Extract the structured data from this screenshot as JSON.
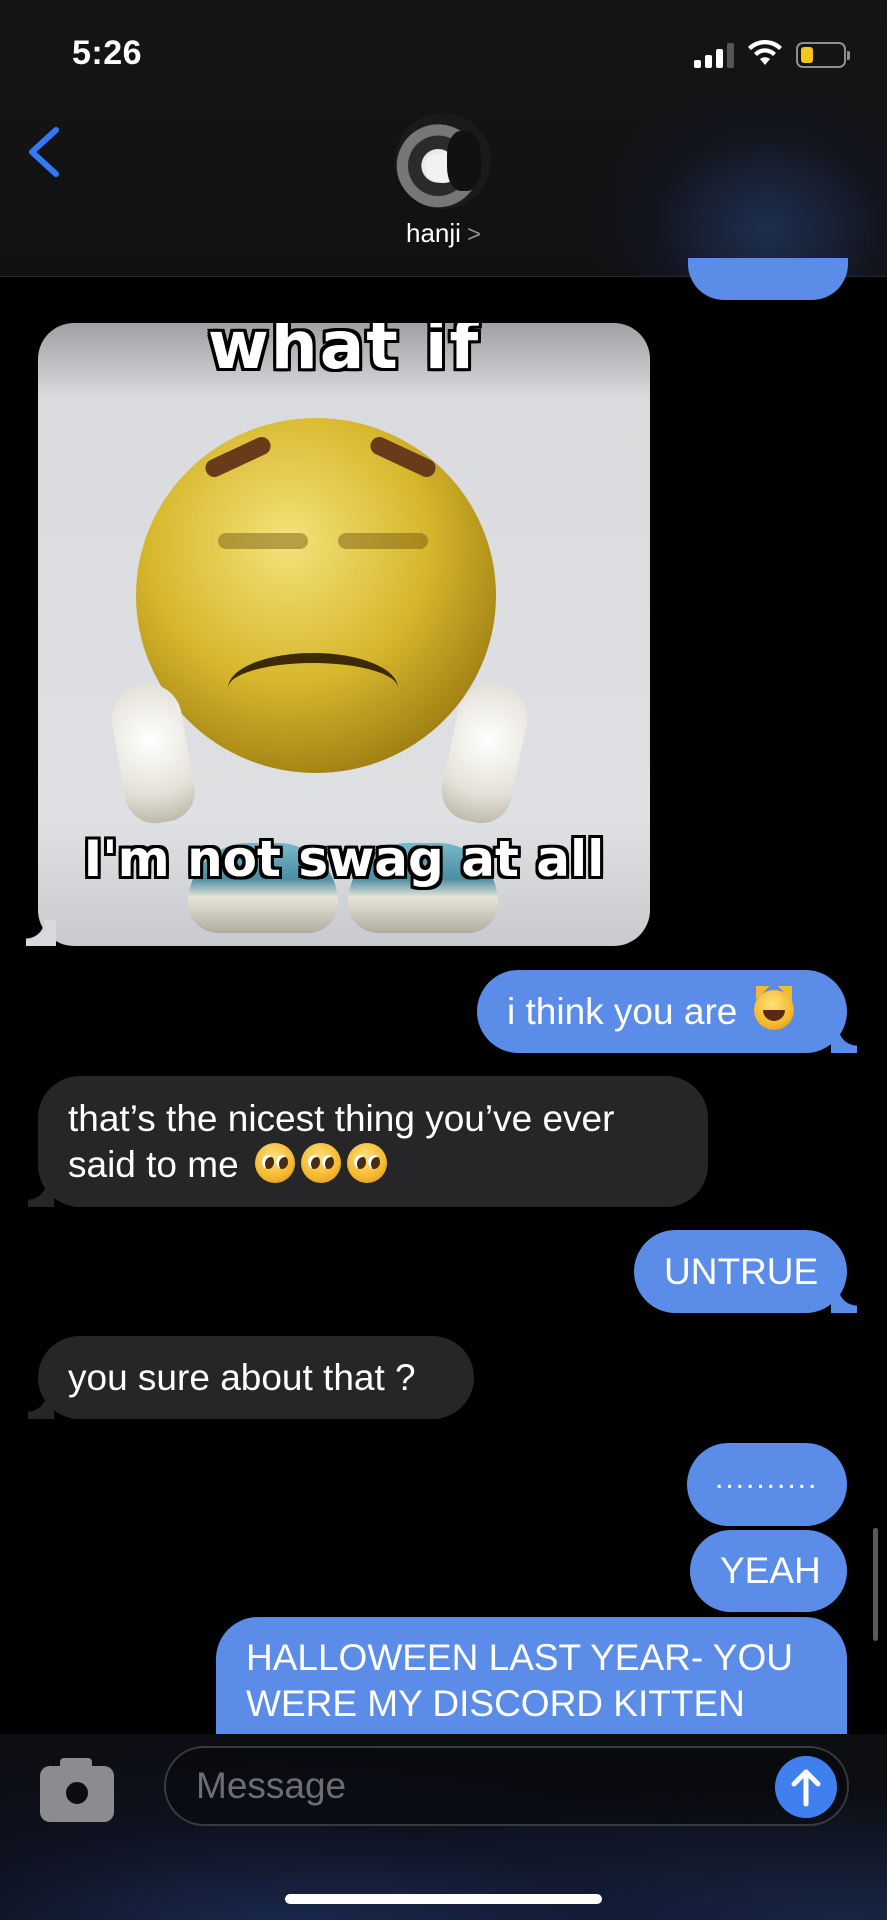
{
  "status_bar": {
    "time": "5:26",
    "icons": [
      "cellular-signal-icon",
      "wifi-icon",
      "battery-low-icon"
    ]
  },
  "header": {
    "contact_name": "hanji",
    "chevron": ">",
    "back_icon": "chevron-left-icon",
    "accent": "#3478f6"
  },
  "meme": {
    "caption_top": "what if",
    "caption_bottom": "I'm not swag at all"
  },
  "messages": [
    {
      "from": "me",
      "text": "i think you are",
      "emoji": [
        "grinning-cat-emoji"
      ]
    },
    {
      "from": "them",
      "line1": "that’s the nicest thing you’ve ever",
      "line2": "said to me",
      "emoji": [
        "pleading-face-emoji",
        "pleading-face-emoji",
        "pleading-face-emoji"
      ]
    },
    {
      "from": "me",
      "text": "UNTRUE"
    },
    {
      "from": "them",
      "text": "you sure about that ?"
    },
    {
      "from": "me",
      "text": ".........."
    },
    {
      "from": "me",
      "text": "YEAH"
    },
    {
      "from": "me",
      "line1": "HALLOWEEN LAST YEAR- YOU",
      "line2": "WERE MY DISCORD KITTEN"
    }
  ],
  "composer": {
    "placeholder": "Message",
    "camera_icon": "camera-icon",
    "send_icon": "send-arrow-icon"
  },
  "colors": {
    "outgoing_bubble": "#5b8de8",
    "incoming_bubble": "#262628",
    "background": "#000000"
  }
}
